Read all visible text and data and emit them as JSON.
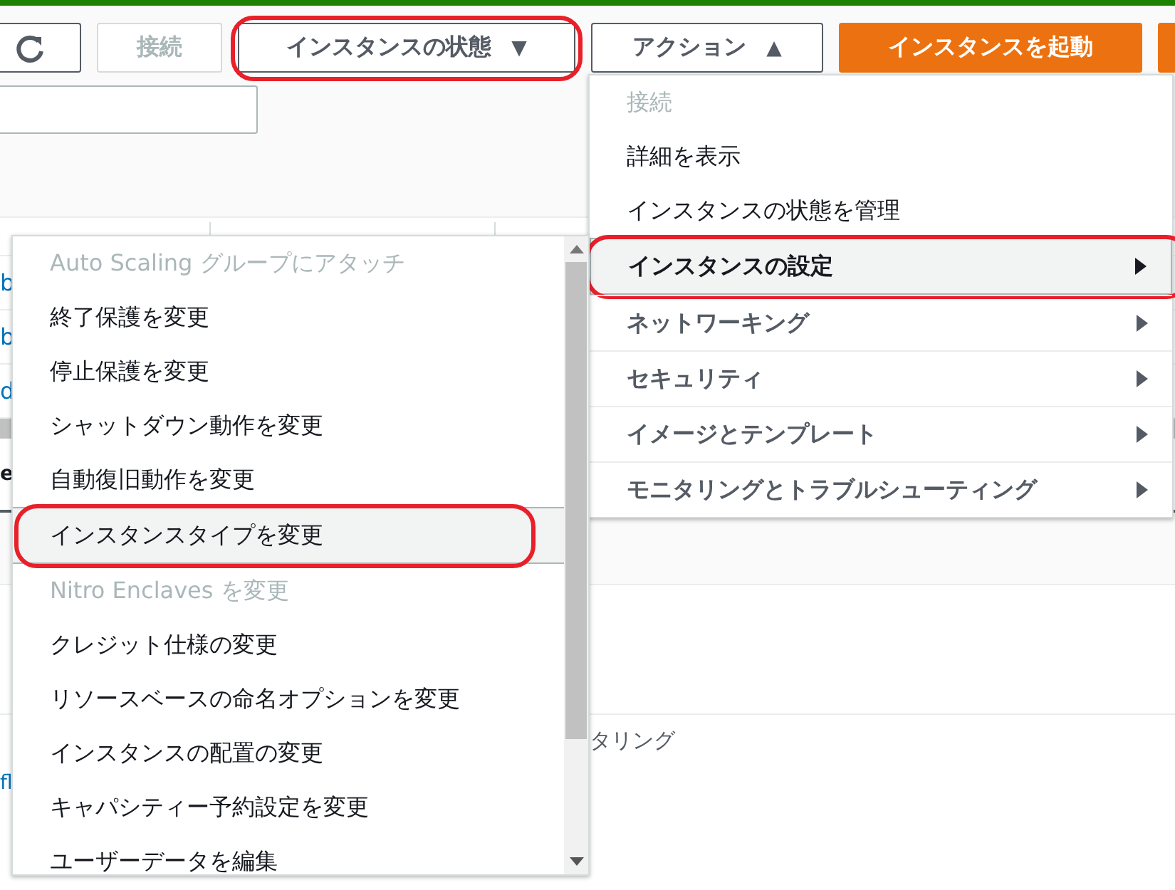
{
  "toolbar": {
    "buttons": [
      {
        "kind": "refresh",
        "disabled": false,
        "annotated": false
      },
      {
        "kind": "button",
        "label": "接続",
        "disabled": true,
        "annotated": false
      },
      {
        "kind": "dropdown",
        "label": "インスタンスの状態",
        "caret": "▼",
        "disabled": false,
        "annotated": true
      },
      {
        "kind": "dropdown",
        "label": "アクション",
        "caret": "▲",
        "disabled": false,
        "annotated": false
      },
      {
        "kind": "primary",
        "label": "インスタンスを起動",
        "disabled": false,
        "annotated": false
      },
      {
        "kind": "primary",
        "disabled": false,
        "annotated": false
      }
    ]
  },
  "table": {
    "rows": [
      {
        "cell": "b"
      },
      {
        "cell": "b"
      },
      {
        "cell": "d"
      }
    ]
  },
  "details": {
    "title": "e",
    "tab": "タリング",
    "link": "fl"
  },
  "actions_menu": {
    "items": [
      {
        "kind": "action",
        "label": "接続",
        "disabled": true,
        "selected": false,
        "annotated": false
      },
      {
        "kind": "action",
        "label": "詳細を表示",
        "disabled": false,
        "selected": false,
        "annotated": false
      },
      {
        "kind": "action",
        "label": "インスタンスの状態を管理",
        "disabled": false,
        "selected": false,
        "annotated": false
      },
      {
        "kind": "submenu",
        "label": "インスタンスの設定",
        "disabled": false,
        "selected": true,
        "annotated": true
      },
      {
        "kind": "submenu",
        "label": "ネットワーキング",
        "disabled": false,
        "selected": false,
        "annotated": false
      },
      {
        "kind": "submenu",
        "label": "セキュリティ",
        "disabled": false,
        "selected": false,
        "annotated": false
      },
      {
        "kind": "submenu",
        "label": "イメージとテンプレート",
        "disabled": false,
        "selected": false,
        "annotated": false
      },
      {
        "kind": "submenu",
        "label": "モニタリングとトラブルシューティング",
        "disabled": false,
        "selected": false,
        "annotated": false
      }
    ]
  },
  "settings_submenu": {
    "items": [
      {
        "label": "Auto Scaling グループにアタッチ",
        "disabled": true,
        "selected": false,
        "annotated": false
      },
      {
        "label": "終了保護を変更",
        "disabled": false,
        "selected": false,
        "annotated": false
      },
      {
        "label": "停止保護を変更",
        "disabled": false,
        "selected": false,
        "annotated": false
      },
      {
        "label": "シャットダウン動作を変更",
        "disabled": false,
        "selected": false,
        "annotated": false
      },
      {
        "label": "自動復旧動作を変更",
        "disabled": false,
        "selected": false,
        "annotated": false
      },
      {
        "label": "インスタンスタイプを変更",
        "disabled": false,
        "selected": true,
        "annotated": true
      },
      {
        "label": "Nitro Enclaves を変更",
        "disabled": true,
        "selected": false,
        "annotated": false
      },
      {
        "label": "クレジット仕様の変更",
        "disabled": false,
        "selected": false,
        "annotated": false
      },
      {
        "label": "リソースベースの命名オプションを変更",
        "disabled": false,
        "selected": false,
        "annotated": false
      },
      {
        "label": "インスタンスの配置の変更",
        "disabled": false,
        "selected": false,
        "annotated": false
      },
      {
        "label": "キャパシティー予約設定を変更",
        "disabled": false,
        "selected": false,
        "annotated": false
      },
      {
        "label": "ユーザーデータを編集",
        "disabled": false,
        "selected": false,
        "annotated": false
      }
    ]
  }
}
